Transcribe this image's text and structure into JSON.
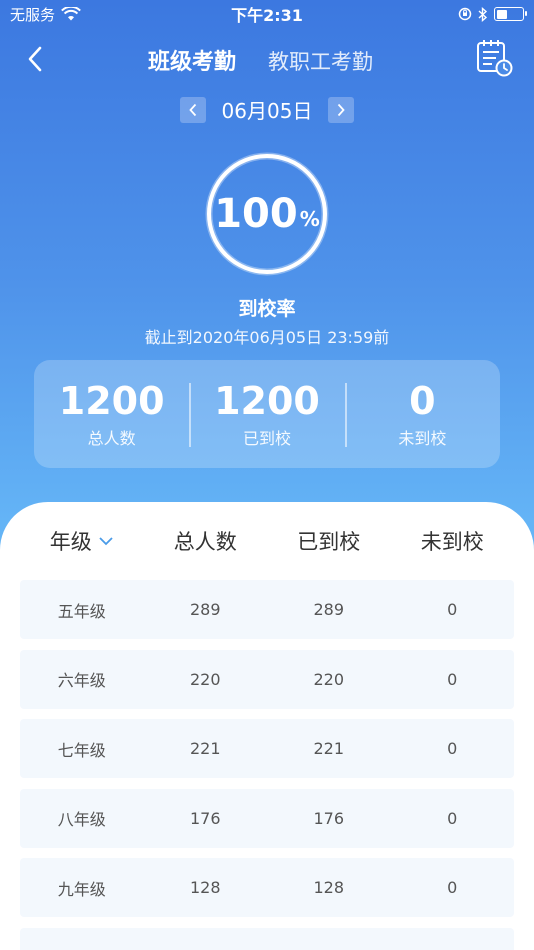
{
  "status": {
    "carrier": "无服务",
    "time": "下午2:31"
  },
  "nav": {
    "tab_class": "班级考勤",
    "tab_staff": "教职工考勤"
  },
  "date": {
    "current": "06月05日"
  },
  "rate": {
    "value": "100",
    "unit": "%",
    "label": "到校率",
    "deadline": "截止到2020年06月05日  23:59前"
  },
  "summary": {
    "total": {
      "value": "1200",
      "label": "总人数"
    },
    "arrived": {
      "value": "1200",
      "label": "已到校"
    },
    "absent": {
      "value": "0",
      "label": "未到校"
    }
  },
  "table": {
    "headers": {
      "grade": "年级",
      "total": "总人数",
      "arrived": "已到校",
      "absent": "未到校"
    },
    "rows": [
      {
        "grade": "五年级",
        "total": "289",
        "arrived": "289",
        "absent": "0"
      },
      {
        "grade": "六年级",
        "total": "220",
        "arrived": "220",
        "absent": "0"
      },
      {
        "grade": "七年级",
        "total": "221",
        "arrived": "221",
        "absent": "0"
      },
      {
        "grade": "八年级",
        "total": "176",
        "arrived": "176",
        "absent": "0"
      },
      {
        "grade": "九年级",
        "total": "128",
        "arrived": "128",
        "absent": "0"
      }
    ]
  },
  "colors": {
    "gradient_top": "#3c78e0",
    "gradient_bottom": "#6cc0f8",
    "row_background": "#f3f8fd",
    "dropdown_accent": "#4a9be8"
  },
  "icons": {
    "wifi": "wifi-icon",
    "lock_rotation": "orientation-lock-icon",
    "bluetooth": "bluetooth-icon",
    "battery": "battery-icon",
    "back": "chevron-left-icon",
    "calendar": "calendar-clock-icon",
    "prev": "chevron-left-icon",
    "next": "chevron-right-icon",
    "dropdown": "chevron-down-icon"
  }
}
